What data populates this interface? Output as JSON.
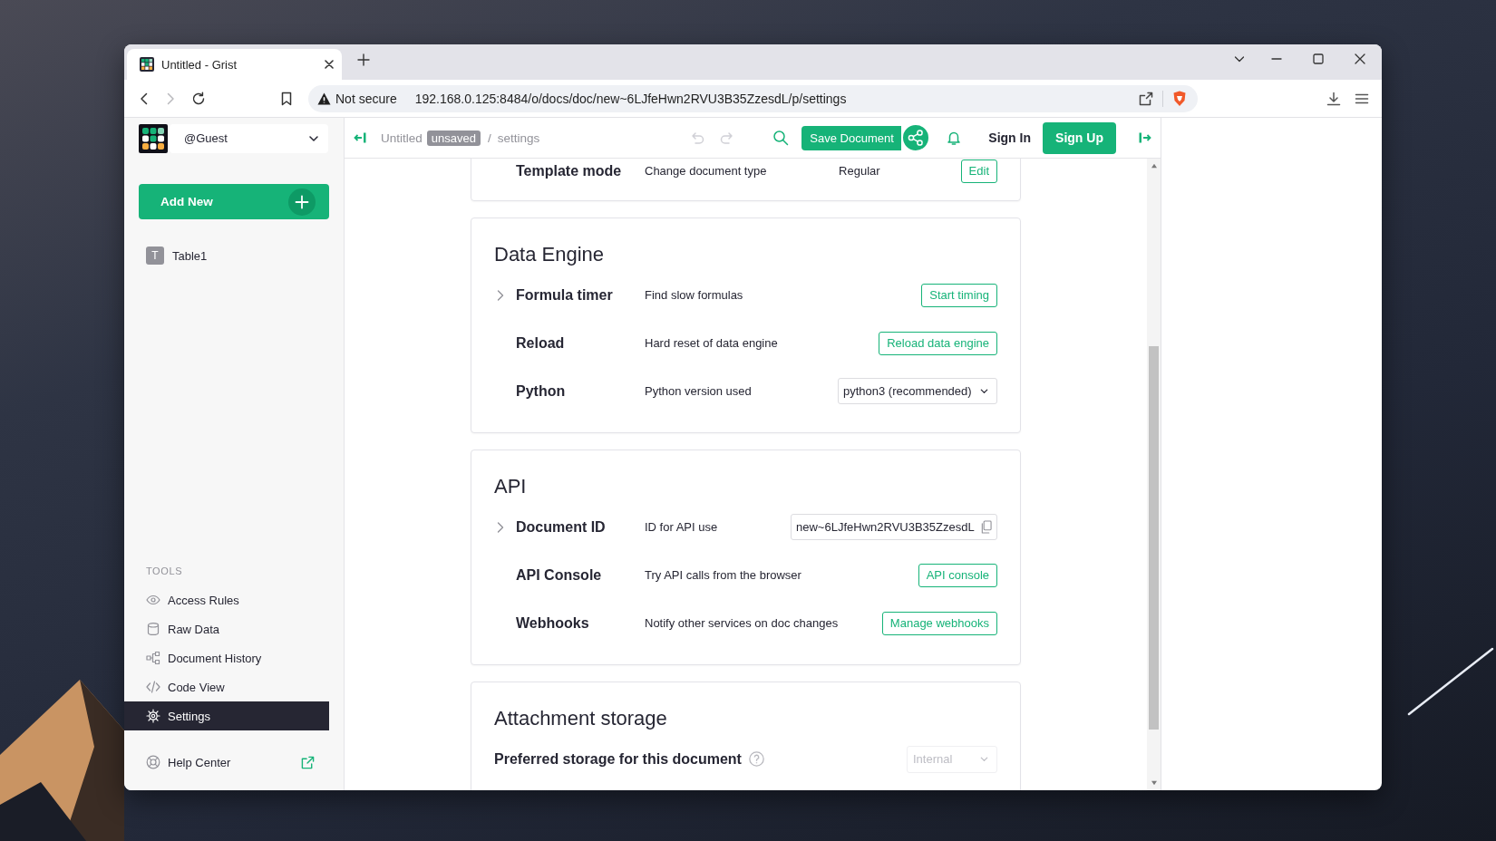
{
  "browser": {
    "tab": {
      "title": "Untitled - Grist",
      "selected": true
    },
    "back": {
      "disabled": false
    },
    "forward": {
      "disabled": true
    },
    "address": {
      "warning": "Not secure",
      "url": "192.168.0.125:8484/o/docs/doc/new~6LJfeHwn2RVU3B35ZzesdL/p/settings"
    }
  },
  "sidebar": {
    "org": "@Guest",
    "add_new": "Add New",
    "pages": [
      {
        "label": "Table1",
        "initial": "T",
        "selected": false
      }
    ],
    "tools_heading": "TOOLS",
    "tools": [
      {
        "label": "Access Rules",
        "selected": false
      },
      {
        "label": "Raw Data",
        "selected": false
      },
      {
        "label": "Document History",
        "selected": false
      },
      {
        "label": "Code View",
        "selected": false
      },
      {
        "label": "Settings",
        "selected": true
      }
    ],
    "help": {
      "label": "Help Center"
    }
  },
  "header": {
    "doc_name": "Untitled",
    "badge": "unsaved",
    "separator": "/",
    "page": "settings",
    "undo": {
      "disabled": true
    },
    "redo": {
      "disabled": true
    },
    "save": "Save Document",
    "sign_in": "Sign In",
    "sign_up": "Sign Up"
  },
  "sections": [
    {
      "rows": [
        {
          "kind": "value_button",
          "label": "Template mode",
          "description": "Change document type",
          "value": "Regular",
          "button": "Edit",
          "expandable": false
        }
      ]
    },
    {
      "title": "Data Engine",
      "rows": [
        {
          "kind": "button",
          "label": "Formula timer",
          "description": "Find slow formulas",
          "button": "Start timing",
          "expandable": true,
          "expanded": false
        },
        {
          "kind": "button",
          "label": "Reload",
          "description": "Hard reset of data engine",
          "button": "Reload data engine",
          "expandable": false
        },
        {
          "kind": "select",
          "label": "Python",
          "description": "Python version used",
          "value": "python3 (recommended)",
          "disabled": false,
          "expandable": false
        }
      ]
    },
    {
      "title": "API",
      "rows": [
        {
          "kind": "copy_field",
          "label": "Document ID",
          "description": "ID for API use",
          "value": "new~6LJfeHwn2RVU3B35ZzesdL",
          "expandable": true,
          "expanded": false
        },
        {
          "kind": "button",
          "label": "API Console",
          "description": "Try API calls from the browser",
          "button": "API console",
          "expandable": false
        },
        {
          "kind": "button",
          "label": "Webhooks",
          "description": "Notify other services on doc changes",
          "button": "Manage webhooks",
          "expandable": false
        }
      ]
    },
    {
      "title": "Attachment storage",
      "rows": [
        {
          "kind": "wide_select",
          "label": "Preferred storage for this document",
          "help": true,
          "value": "Internal",
          "disabled": true,
          "expandable": false
        }
      ]
    }
  ]
}
